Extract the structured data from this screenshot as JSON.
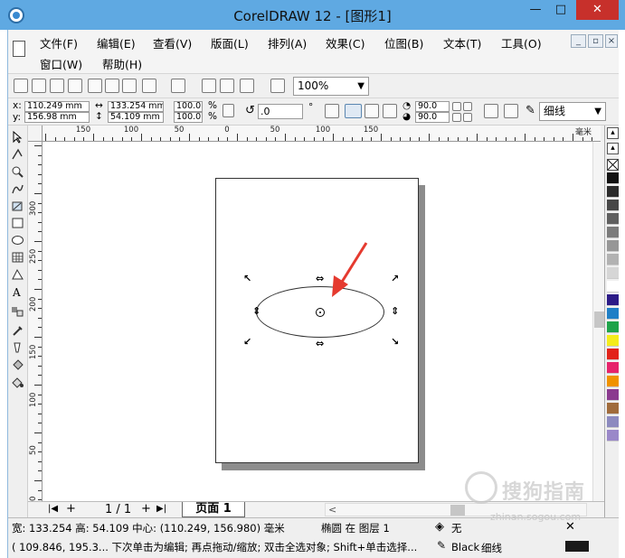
{
  "window": {
    "title": "CorelDRAW 12 - [图形1]",
    "minimize": "—",
    "maximize": "□",
    "close": "✕"
  },
  "menu": {
    "items": [
      "文件(F)",
      "编辑(E)",
      "查看(V)",
      "版面(L)",
      "排列(A)",
      "效果(C)",
      "位图(B)",
      "文本(T)",
      "工具(O)",
      "窗口(W)",
      "帮助(H)"
    ],
    "mdi": [
      "_",
      "▫",
      "×"
    ]
  },
  "standard_toolbar": {
    "zoom": "100%"
  },
  "property_bar": {
    "x_label": "x:",
    "x": "110.249 mm",
    "y_label": "y:",
    "y": "156.98 mm",
    "width": "133.254 mm",
    "height": "54.109 mm",
    "scale_x": "100.0",
    "scale_y": "100.0",
    "percent": "%",
    "rotation": ".0",
    "degree": "°",
    "start_angle": "90.0",
    "end_angle": "90.0",
    "outline": "细线"
  },
  "rulers": {
    "horizontal": [
      "150",
      "100",
      "50",
      "0",
      "50",
      "100",
      "150"
    ],
    "horizontal_unit": "毫米",
    "vertical": [
      "300",
      "250",
      "200",
      "150",
      "100",
      "50",
      "0"
    ]
  },
  "document": {
    "page_counter": "1 / 1",
    "page_tab": "页面 1"
  },
  "palette": {
    "colors": [
      "#111111",
      "#2b2b2b",
      "#474747",
      "#5f5f5f",
      "#7b7b7b",
      "#979797",
      "#b2b2b2",
      "#d6d6d6",
      "#ffffff",
      "#2c1b87",
      "#1f7fc6",
      "#1ea34a",
      "#f4ec1c",
      "#e2231a",
      "#e6236b",
      "#f09200",
      "#8b3a8f",
      "#a06b3b",
      "#8c8abf",
      "#9a88c9"
    ]
  },
  "status": {
    "size_center": "宽: 133.254  高: 54.109  中心: (110.249, 156.980)  毫米",
    "object_info": "椭圆 在 图层 1",
    "cursor_hint": "( 109.846, 195.3...   下次单击为编辑; 再点拖动/缩放; 双击全选对象; Shift+单击选择...",
    "fill_label": "无",
    "outline_color": "Black",
    "outline_width": "细线"
  },
  "watermark": {
    "text": "搜狗指南",
    "url": "zhinan.sogou.com"
  },
  "colors": {
    "titlebar": "#5fa9e2",
    "close": "#c7302b",
    "arrow": "#e53a2f"
  }
}
